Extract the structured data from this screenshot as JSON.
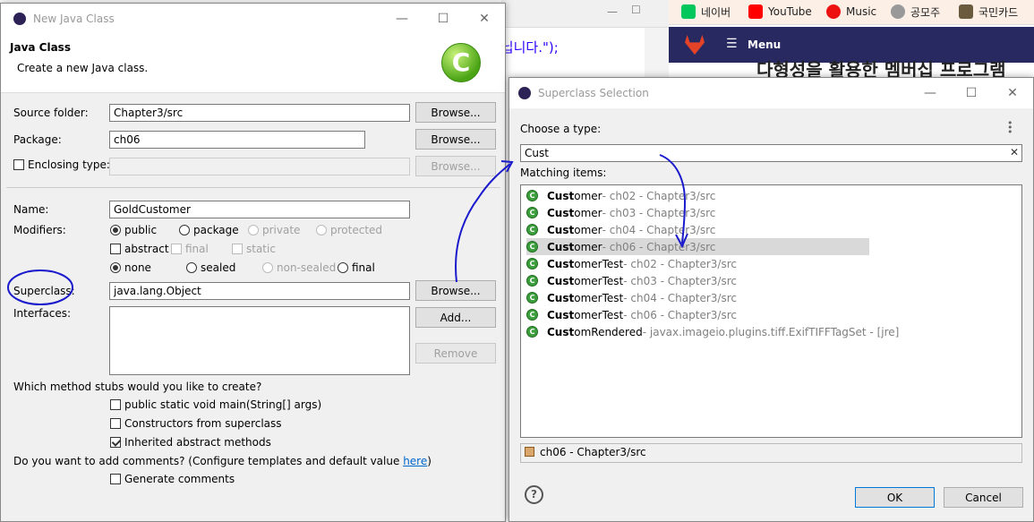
{
  "background": {
    "editor_code_text": "다닙니다.\");",
    "bookmarks": [
      {
        "label": "네이버",
        "icon": "naver-icon",
        "color": "#03c75a"
      },
      {
        "label": "YouTube",
        "icon": "youtube-icon",
        "color": "#ff0000"
      },
      {
        "label": "Music",
        "icon": "music-icon",
        "color": "#e11"
      },
      {
        "label": "공모주",
        "icon": "globe-icon",
        "color": "#999"
      },
      {
        "label": "국민카드",
        "icon": "kb-card-icon",
        "color": "#6b5b3e"
      }
    ],
    "gitlab_menu_label": "Menu",
    "page_heading": "다형성을 활용한 멤버십 프로그램"
  },
  "new_class_dialog": {
    "title": "New Java Class",
    "header_title": "Java Class",
    "header_subtitle": "Create a new Java class.",
    "source_folder_label": "Source folder:",
    "source_folder_value": "Chapter3/src",
    "package_label": "Package:",
    "package_value": "ch06",
    "enclosing_type_label": "Enclosing type:",
    "browse_label": "Browse...",
    "name_label": "Name:",
    "name_value": "GoldCustomer",
    "modifiers_label": "Modifiers:",
    "modifiers_row1": [
      "public",
      "package",
      "private",
      "protected"
    ],
    "modifiers_row2": [
      "abstract",
      "final",
      "static"
    ],
    "modifiers_row3": [
      "none",
      "sealed",
      "non-sealed",
      "final"
    ],
    "superclass_label": "Superclass:",
    "superclass_value": "java.lang.Object",
    "interfaces_label": "Interfaces:",
    "add_label": "Add...",
    "remove_label": "Remove",
    "stubs_question": "Which method stubs would you like to create?",
    "stubs": [
      {
        "label": "public static void main(String[] args)",
        "checked": false
      },
      {
        "label": "Constructors from superclass",
        "checked": false
      },
      {
        "label": "Inherited abstract methods",
        "checked": true
      }
    ],
    "comments_question": "Do you want to add comments? (Configure templates and default value ",
    "comments_link": "here",
    "comments_question_end": ")",
    "generate_comments_label": "Generate comments"
  },
  "superclass_dialog": {
    "title": "Superclass Selection",
    "choose_label": "Choose a type:",
    "search_value": "Cust",
    "matching_label": "Matching items:",
    "items": [
      {
        "match": "Cust",
        "rest": "omer",
        "qualifier": " - ch02 - Chapter3/src"
      },
      {
        "match": "Cust",
        "rest": "omer",
        "qualifier": " - ch03 - Chapter3/src"
      },
      {
        "match": "Cust",
        "rest": "omer",
        "qualifier": " - ch04 - Chapter3/src"
      },
      {
        "match": "Cust",
        "rest": "omer",
        "qualifier": " - ch06 - Chapter3/src"
      },
      {
        "match": "Cust",
        "rest": "omerTest",
        "qualifier": " - ch02 - Chapter3/src"
      },
      {
        "match": "Cust",
        "rest": "omerTest",
        "qualifier": " - ch03 - Chapter3/src"
      },
      {
        "match": "Cust",
        "rest": "omerTest",
        "qualifier": " - ch04 - Chapter3/src"
      },
      {
        "match": "Cust",
        "rest": "omerTest",
        "qualifier": " - ch06 - Chapter3/src"
      },
      {
        "match": "Cust",
        "rest": "omRendered",
        "qualifier": " - javax.imageio.plugins.tiff.ExifTIFFTagSet - [jre]"
      }
    ],
    "selected_index": 3,
    "status_value": "ch06 - Chapter3/src",
    "ok_label": "OK",
    "cancel_label": "Cancel"
  },
  "colors": {
    "annotation_ink": "#1a1acc",
    "selection": "#d9d9d9",
    "class_icon": "#3c9e3c"
  }
}
